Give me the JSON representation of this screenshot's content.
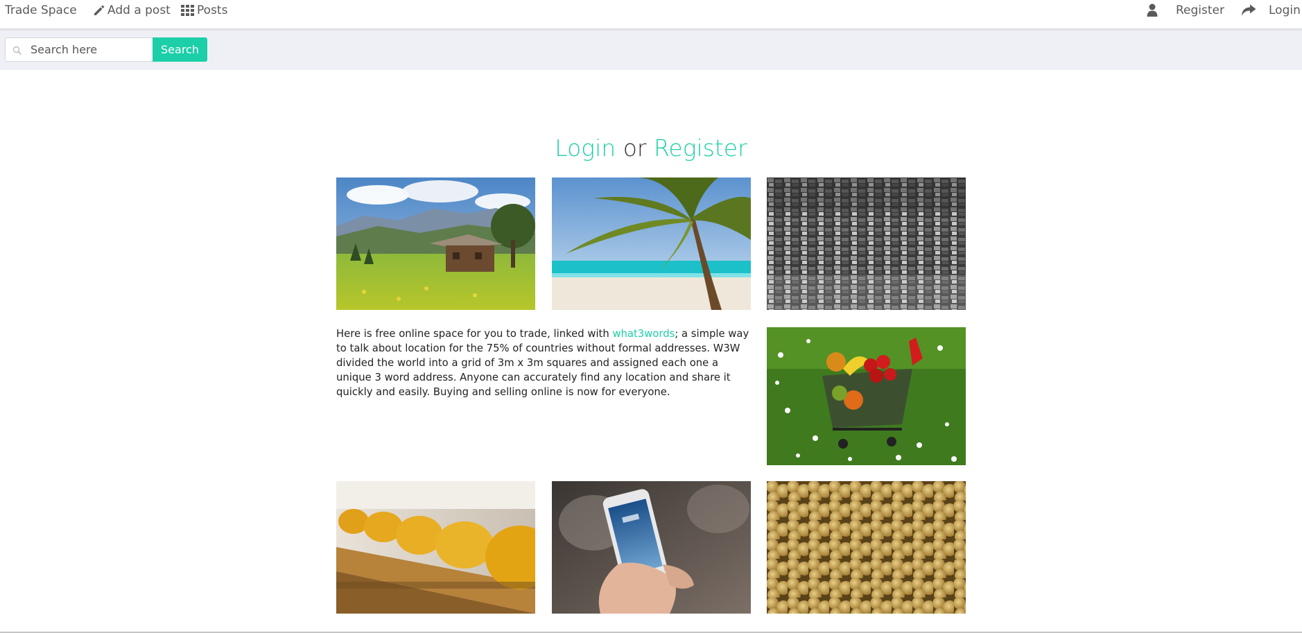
{
  "navbar": {
    "brand": "Trade Space",
    "add_post": "Add a post",
    "posts": "Posts",
    "register": "Register",
    "login": "Login",
    "icons": {
      "add_post": "pencil-icon",
      "posts": "grid-icon",
      "register": "user-icon",
      "login": "share-arrow-icon"
    }
  },
  "search": {
    "placeholder": "Search here",
    "value": "",
    "button": "Search"
  },
  "heading": {
    "login": "Login",
    "connector": "or",
    "register": "Register"
  },
  "description": {
    "before_link": "Here is free online space for you to trade, linked with ",
    "link": "what3words",
    "after_link": "; a simple way to talk about location for the 75% of countries without formal addresses. W3W divided the world into a grid of 3m x 3m squares and assigned each one a unique 3 word address. Anyone can accurately find any location and share it quickly and easily. Buying and selling online is now for everyone."
  },
  "images": [
    "mountain-cabin-photo",
    "palm-beach-photo",
    "city-hillside-photo",
    "fruit-cart-photo",
    "cheese-wheels-photo",
    "smartphone-hand-photo",
    "coins-pile-photo"
  ],
  "colors": {
    "accent": "#1ccfa8",
    "search_strip": "#eef0f5",
    "nav_text": "#5a5a5a"
  }
}
